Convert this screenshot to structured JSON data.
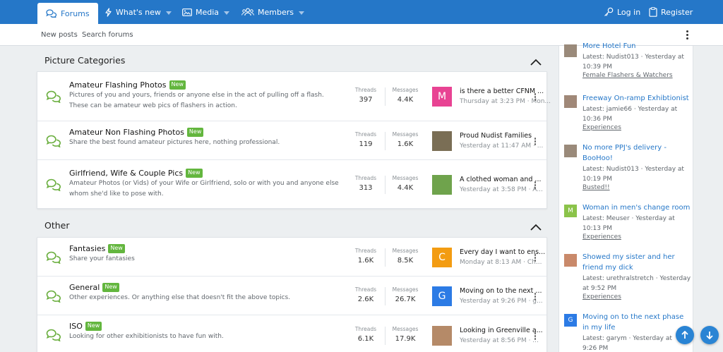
{
  "nav": {
    "tabs": [
      {
        "label": "Forums",
        "icon": "chat-bubbles-icon"
      },
      {
        "label": "What's new",
        "icon": "lightning-icon"
      },
      {
        "label": "Media",
        "icon": "image-icon"
      },
      {
        "label": "Members",
        "icon": "members-icon"
      }
    ],
    "login": "Log in",
    "register": "Register"
  },
  "subnav": {
    "new_posts": "New posts",
    "search_forums": "Search forums"
  },
  "sections": [
    {
      "title": "Picture Categories",
      "nodes": [
        {
          "title": "Amateur Flashing Photos",
          "badge": "New",
          "desc": "Pictures of you and yours, friends or anyone else in the act of pulling off a flash. These can be amateur web pics of flashers in action.",
          "threads_label": "Threads",
          "threads": "397",
          "messages_label": "Messages",
          "messages": "4.4K",
          "latest_title": "is there a better CFNM ...",
          "latest_meta": "Thursday at 3:23 PM · Mon...",
          "avatar_letter": "M",
          "avatar_color": "#e84393"
        },
        {
          "title": "Amateur Non Flashing Photos",
          "badge": "New",
          "desc": "Share the best found amateur pictures here, nothing professional.",
          "threads_label": "Threads",
          "threads": "119",
          "messages_label": "Messages",
          "messages": "1.6K",
          "latest_title": "Proud Nudist Families",
          "latest_meta": "Yesterday at 11:47 AM · ...",
          "avatar_letter": "",
          "avatar_color": "#7a6e55"
        },
        {
          "title": "Girlfriend, Wife & Couple Pics",
          "badge": "New",
          "desc": "Amateur Photos (or Vids) of your Wife or Girlfriend, solo or with you and anyone else whom she'd like to pose with.",
          "threads_label": "Threads",
          "threads": "313",
          "messages_label": "Messages",
          "messages": "4.4K",
          "latest_title": "A clothed woman and ...",
          "latest_meta": "Yesterday at 3:58 PM · A...",
          "avatar_letter": "",
          "avatar_color": "#6fa34c"
        }
      ]
    },
    {
      "title": "Other",
      "nodes": [
        {
          "title": "Fantasies",
          "badge": "New",
          "desc": "Share your fantasies",
          "threads_label": "Threads",
          "threads": "1.6K",
          "messages_label": "Messages",
          "messages": "8.5K",
          "latest_title": "Every day I want to ens...",
          "latest_meta": "Monday at 8:13 AM · Ch...",
          "avatar_letter": "C",
          "avatar_color": "#f39c12"
        },
        {
          "title": "General",
          "badge": "New",
          "desc": "Other experiences. Or anything else that doesn't fit the above topics.",
          "threads_label": "Threads",
          "threads": "2.6K",
          "messages_label": "Messages",
          "messages": "26.7K",
          "latest_title": "Moving on to the next ...",
          "latest_meta": "Yesterday at 9:26 PM · g...",
          "avatar_letter": "G",
          "avatar_color": "#2c7be5"
        },
        {
          "title": "ISO",
          "badge": "New",
          "desc": "Looking for other exhibitionists to have fun with.",
          "threads_label": "Threads",
          "threads": "6.1K",
          "messages_label": "Messages",
          "messages": "17.9K",
          "latest_title": "Looking in Greenville a...",
          "latest_meta": "Yesterday at 8:56 PM · ...",
          "avatar_letter": "",
          "avatar_color": "#b58a68"
        }
      ]
    }
  ],
  "sidebar": {
    "items": [
      {
        "title": "More Hotel Fun",
        "lines": [
          "Latest: Nudist013 · Yesterday at",
          "10:39 PM"
        ],
        "forum": "Female Flashers & Watchers",
        "avatar_letter": "",
        "avatar_color": "#9a8a7a"
      },
      {
        "title": "Freeway On-ramp Exhibtionist",
        "lines": [
          "Latest: jamie66 · Yesterday at",
          "10:36 PM"
        ],
        "forum": "Experiences",
        "avatar_letter": "",
        "avatar_color": "#a08878"
      },
      {
        "title": "No more PPJ's delivery - BooHoo!",
        "lines": [
          "Latest: Nudist013 · Yesterday at",
          "10:19 PM"
        ],
        "forum": "Busted!!",
        "avatar_letter": "",
        "avatar_color": "#9a8a7a"
      },
      {
        "title": "Woman in men's change room",
        "lines": [
          "Latest: Meuser · Yesterday at",
          "10:13 PM"
        ],
        "forum": "Experiences",
        "avatar_letter": "M",
        "avatar_color": "#8bc34a"
      },
      {
        "title": "Showed my sister and her friend my dick",
        "lines": [
          "Latest: urethralstretch · Yesterday",
          "at 9:52 PM"
        ],
        "forum": "Experiences",
        "avatar_letter": "",
        "avatar_color": "#c9896a"
      },
      {
        "title": "Moving on to the next phase in my life",
        "lines": [
          "Latest: garym · Yesterday at",
          "9:26 PM"
        ],
        "forum": "",
        "avatar_letter": "G",
        "avatar_color": "#2c7be5"
      }
    ]
  }
}
